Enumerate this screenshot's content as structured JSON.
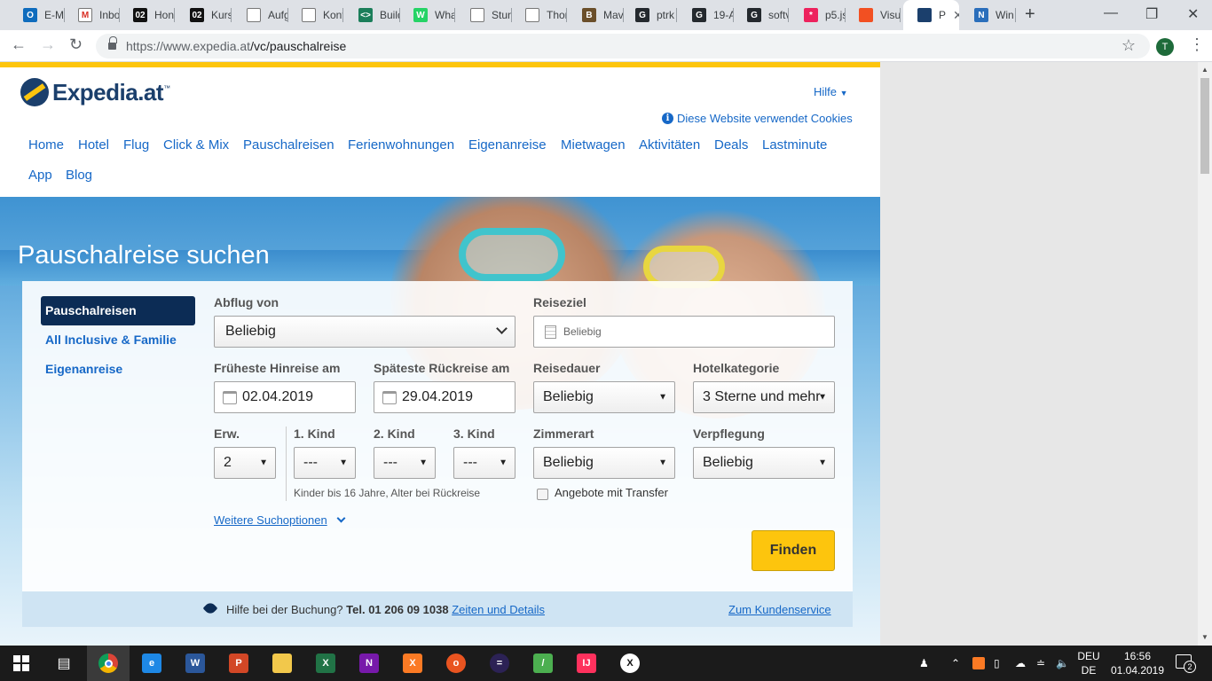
{
  "browser": {
    "tabs": [
      {
        "label": "E-M",
        "icon": "outlook-icon",
        "color": "#0f6cbd",
        "glyph": "O"
      },
      {
        "label": "Inbo",
        "icon": "gmail-icon",
        "color": "#ffffff",
        "glyph": "M"
      },
      {
        "label": "Hon",
        "icon": "o2-icon",
        "color": "#111111",
        "glyph": "02"
      },
      {
        "label": "Kurs",
        "icon": "o2-icon",
        "color": "#111111",
        "glyph": "02"
      },
      {
        "label": "Aufg",
        "icon": "document-icon",
        "color": "#ffffff",
        "glyph": ""
      },
      {
        "label": "Kont",
        "icon": "document-icon",
        "color": "#ffffff",
        "glyph": ""
      },
      {
        "label": "Build",
        "icon": "code-icon",
        "color": "#1b7e5a",
        "glyph": "<>"
      },
      {
        "label": "Wha",
        "icon": "whatsapp-icon",
        "color": "#25d366",
        "glyph": "W"
      },
      {
        "label": "Stun",
        "icon": "document-icon",
        "color": "#ffffff",
        "glyph": ""
      },
      {
        "label": "Thon",
        "icon": "document-icon",
        "color": "#ffffff",
        "glyph": ""
      },
      {
        "label": "Mav",
        "icon": "maven-icon",
        "color": "#6b4f2a",
        "glyph": "B"
      },
      {
        "label": "ptrk",
        "icon": "github-icon",
        "color": "#24292e",
        "glyph": "G"
      },
      {
        "label": "19-A",
        "icon": "github-icon",
        "color": "#24292e",
        "glyph": "G"
      },
      {
        "label": "softv",
        "icon": "github-icon",
        "color": "#24292e",
        "glyph": "G"
      },
      {
        "label": "p5.js",
        "icon": "p5-icon",
        "color": "#ed225d",
        "glyph": "*"
      },
      {
        "label": "Visu",
        "icon": "microsoft-icon",
        "color": "#f25022",
        "glyph": ""
      },
      {
        "label": "P",
        "icon": "expedia-icon",
        "color": "#1b3f6c",
        "glyph": "",
        "active": true
      },
      {
        "label": "Win",
        "icon": "newsfeed-icon",
        "color": "#2a6ebb",
        "glyph": "N"
      }
    ],
    "url_host": "https://www.expedia.at",
    "url_path": "/vc/pauschalreise",
    "profile_initial": "T"
  },
  "site": {
    "brand": "Expedia.at",
    "help_label": "Hilfe",
    "cookies_label": "Diese Website verwendet Cookies",
    "nav": [
      "Home",
      "Hotel",
      "Flug",
      "Click & Mix",
      "Pauschalreisen",
      "Ferienwohnungen",
      "Eigenanreise",
      "Mietwagen",
      "Aktivitäten",
      "Deals",
      "Lastminute",
      "App",
      "Blog"
    ],
    "colors": {
      "brand_navy": "#1b3f6c",
      "link_blue": "#1668c7",
      "accent_yellow": "#fdc50d"
    }
  },
  "search": {
    "title": "Pauschalreise suchen",
    "side_tabs": [
      "Pauschalreisen",
      "All Inclusive & Familie",
      "Eigenanreise"
    ],
    "departure_label": "Abflug von",
    "departure_value": "Beliebig",
    "destination_label": "Reiseziel",
    "destination_placeholder": "Beliebig",
    "earliest_label": "Früheste Hinreise am",
    "earliest_value": "02.04.2019",
    "latest_label": "Späteste Rückreise am",
    "latest_value": "29.04.2019",
    "duration_label": "Reisedauer",
    "duration_value": "Beliebig",
    "category_label": "Hotelkategorie",
    "category_value": "3 Sterne und mehr",
    "adults_label": "Erw.",
    "adults_value": "2",
    "child1_label": "1. Kind",
    "child2_label": "2. Kind",
    "child3_label": "3. Kind",
    "child_value": "---",
    "room_label": "Zimmerart",
    "room_value": "Beliebig",
    "board_label": "Verpflegung",
    "board_value": "Beliebig",
    "children_hint": "Kinder bis 16 Jahre, Alter bei Rückreise",
    "transfer_label": "Angebote mit Transfer",
    "more_options": "Weitere Suchoptionen",
    "find_button": "Finden"
  },
  "helpbar": {
    "text": "Hilfe bei der Buchung?",
    "phone": "Tel. 01 206 09 1038",
    "details_link": "Zeiten und Details",
    "service_link": "Zum Kundenservice"
  },
  "taskbar": {
    "apps": [
      {
        "name": "chrome-icon",
        "color": "#db4437",
        "glyph": "",
        "active": true
      },
      {
        "name": "edge-icon",
        "color": "#1e88e5",
        "glyph": "e"
      },
      {
        "name": "word-icon",
        "color": "#2b579a",
        "glyph": "W"
      },
      {
        "name": "powerpoint-icon",
        "color": "#d24726",
        "glyph": "P"
      },
      {
        "name": "file-explorer-icon",
        "color": "#f2c84b",
        "glyph": ""
      },
      {
        "name": "excel-icon",
        "color": "#217346",
        "glyph": "X"
      },
      {
        "name": "onenote-icon",
        "color": "#7719aa",
        "glyph": "N"
      },
      {
        "name": "xampp-icon",
        "color": "#fb7a24",
        "glyph": "X"
      },
      {
        "name": "ubuntu-icon",
        "color": "#e95420",
        "glyph": "o"
      },
      {
        "name": "eclipse-icon",
        "color": "#2c2255",
        "glyph": "="
      },
      {
        "name": "chart-app-icon",
        "color": "#4caf50",
        "glyph": "/"
      },
      {
        "name": "intellij-icon",
        "color": "#fe315d",
        "glyph": "IJ"
      },
      {
        "name": "xbox-icon",
        "color": "#ffffff",
        "glyph": "X"
      }
    ],
    "lang_top": "DEU",
    "lang_bottom": "DE",
    "time": "16:56",
    "date": "01.04.2019",
    "notification_count": "2"
  }
}
